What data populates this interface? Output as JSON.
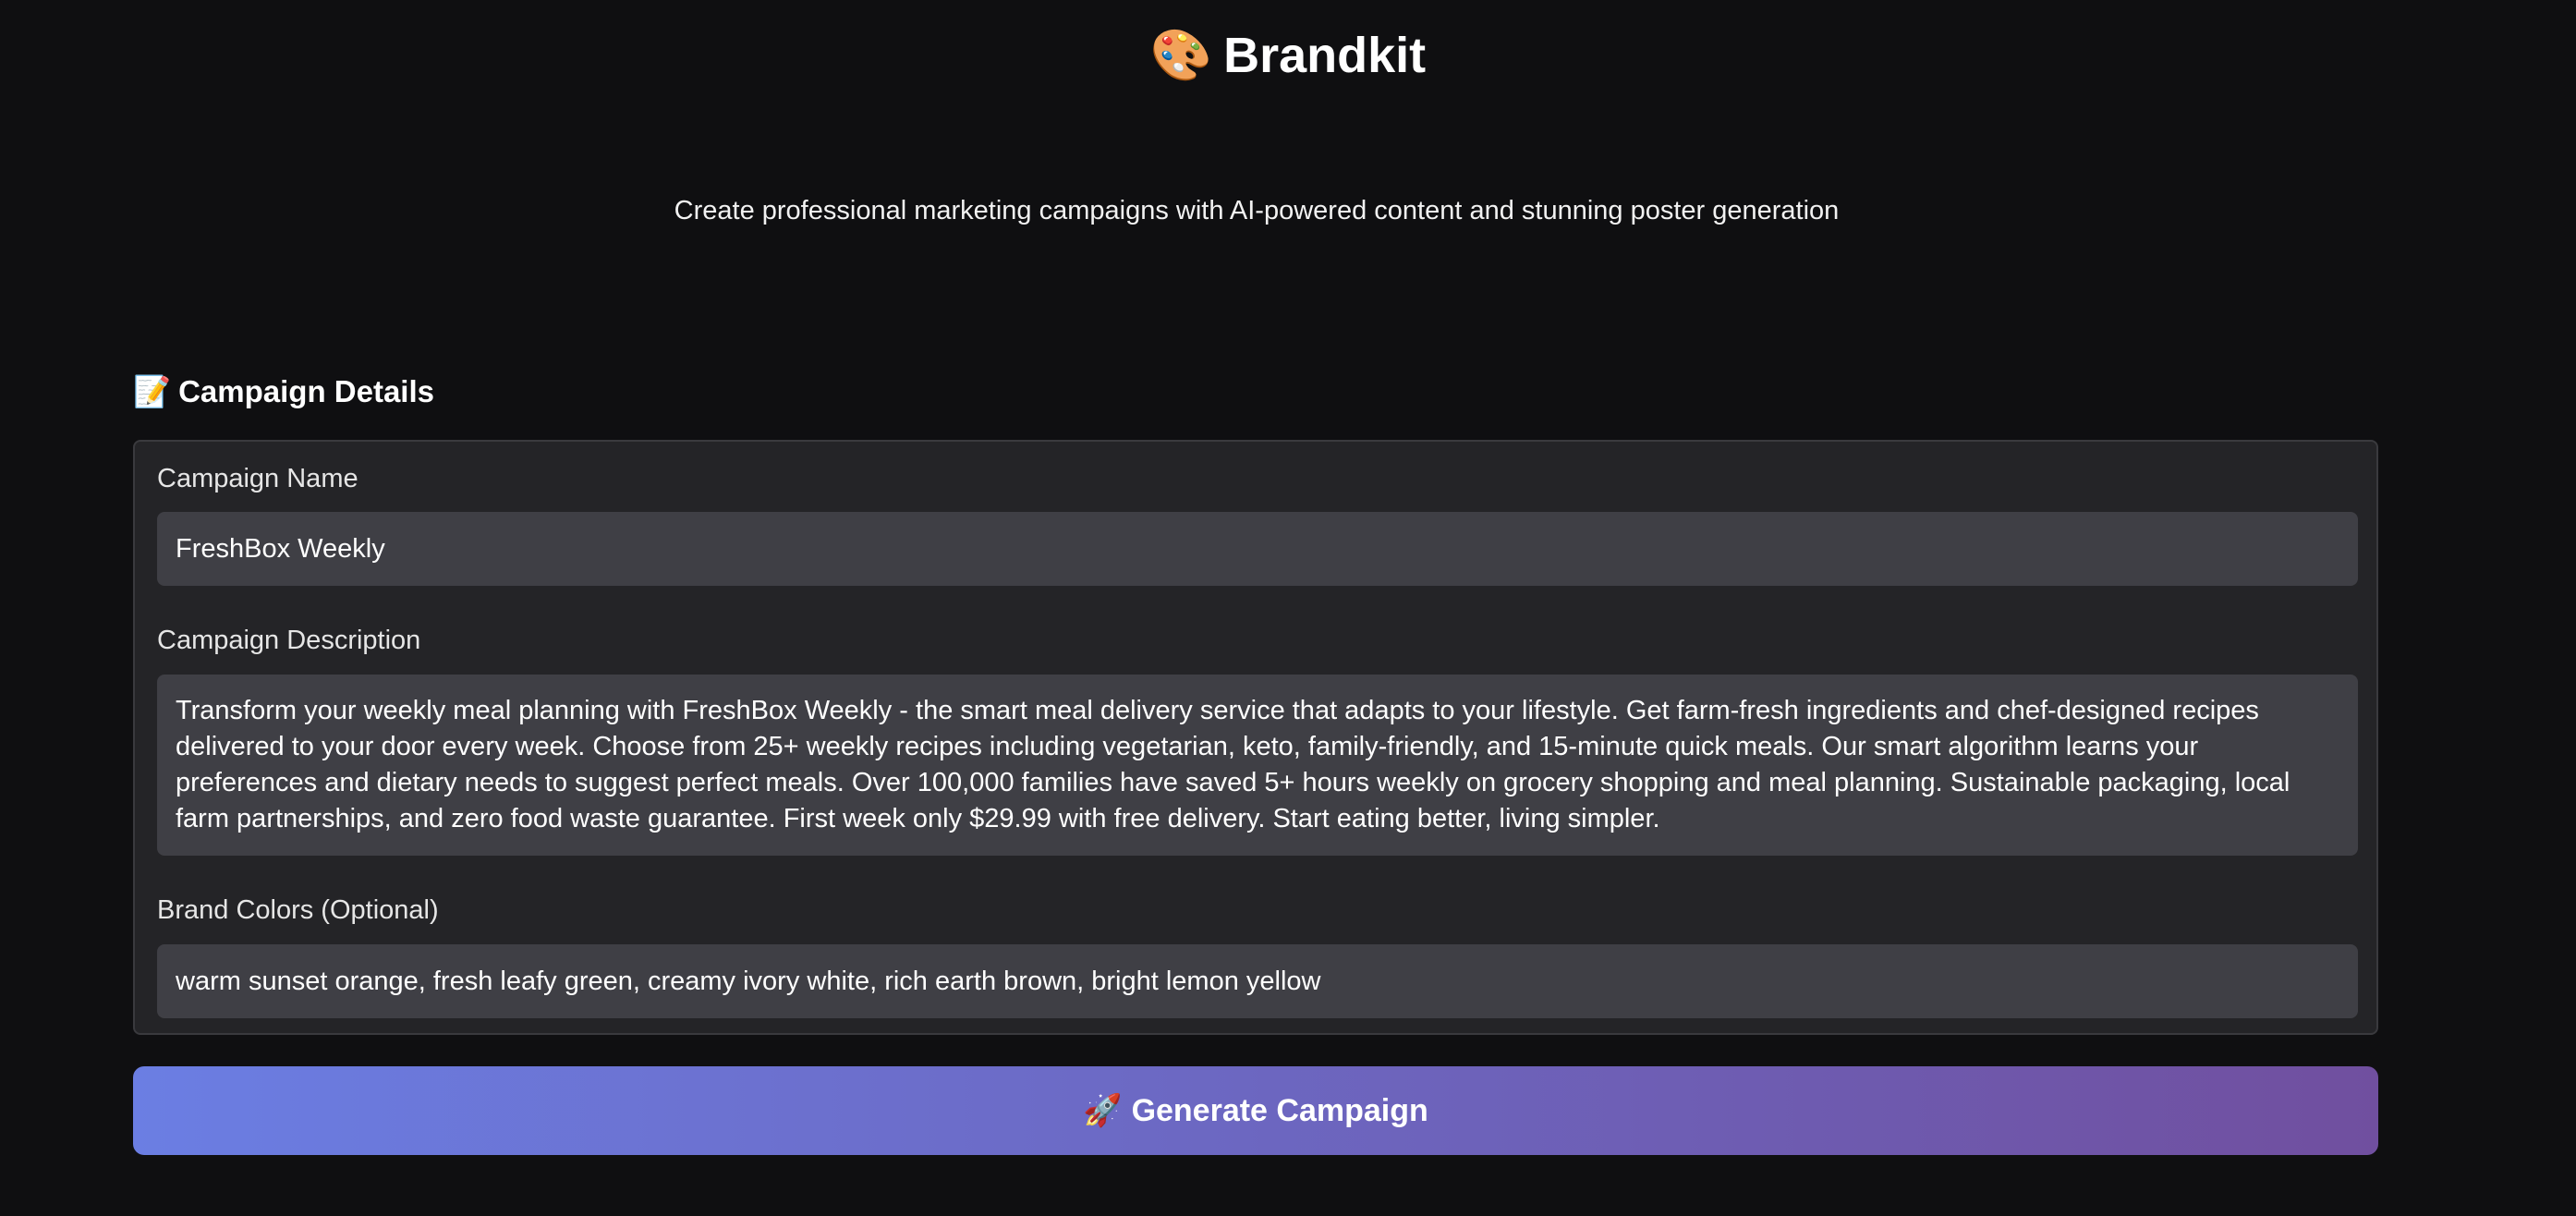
{
  "header": {
    "logo_icon": "🎨",
    "title": "Brandkit",
    "subtitle": "Create professional marketing campaigns with AI-powered content and stunning poster generation"
  },
  "section": {
    "icon": "📝",
    "heading": "Campaign Details"
  },
  "form": {
    "campaign_name": {
      "label": "Campaign Name",
      "value": "FreshBox Weekly"
    },
    "campaign_description": {
      "label": "Campaign Description",
      "value": "Transform your weekly meal planning with FreshBox Weekly - the smart meal delivery service that adapts to your lifestyle. Get farm-fresh ingredients and chef-designed recipes delivered to your door every week. Choose from 25+ weekly recipes including vegetarian, keto, family-friendly, and 15-minute quick meals. Our smart algorithm learns your preferences and dietary needs to suggest perfect meals. Over 100,000 families have saved 5+ hours weekly on grocery shopping and meal planning. Sustainable packaging, local farm partnerships, and zero food waste guarantee. First week only $29.99 with free delivery. Start eating better, living simpler."
    },
    "brand_colors": {
      "label": "Brand Colors (Optional)",
      "value": "warm sunset orange, fresh leafy green, creamy ivory white, rich earth brown, bright lemon yellow"
    }
  },
  "action": {
    "icon": "🚀",
    "label": "Generate Campaign"
  },
  "colors": {
    "background": "#0f0f11",
    "panel": "#242427",
    "field": "#3f3f45",
    "button_gradient_start": "#6b7ee3",
    "button_gradient_end": "#704f9f"
  }
}
